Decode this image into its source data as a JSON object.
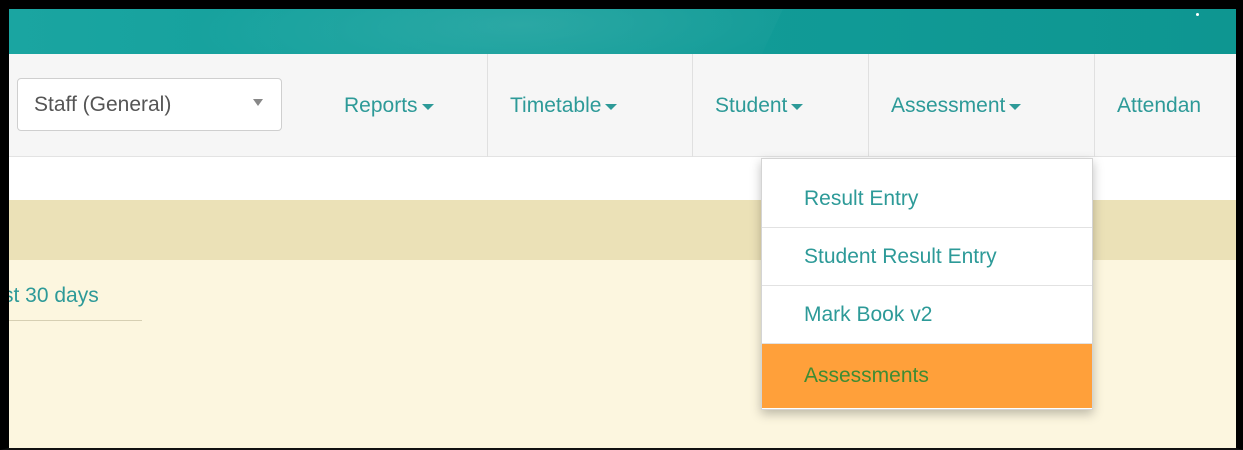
{
  "header": {
    "accent_color": "#119b97"
  },
  "navbar": {
    "role_select": {
      "value": "Staff (General)"
    },
    "menu": [
      {
        "label": "Reports"
      },
      {
        "label": "Timetable"
      },
      {
        "label": "Student"
      },
      {
        "label": "Assessment"
      },
      {
        "label": "Attendan"
      }
    ]
  },
  "content": {
    "recent_link": "st 30 days",
    "background_color": "#fcf6df"
  },
  "dropdown": {
    "items": [
      {
        "label": "Result Entry"
      },
      {
        "label": "Student Result Entry"
      },
      {
        "label": "Mark Book v2"
      },
      {
        "label": "Assessments",
        "active": true,
        "highlight_color": "#ffa03a"
      }
    ]
  }
}
